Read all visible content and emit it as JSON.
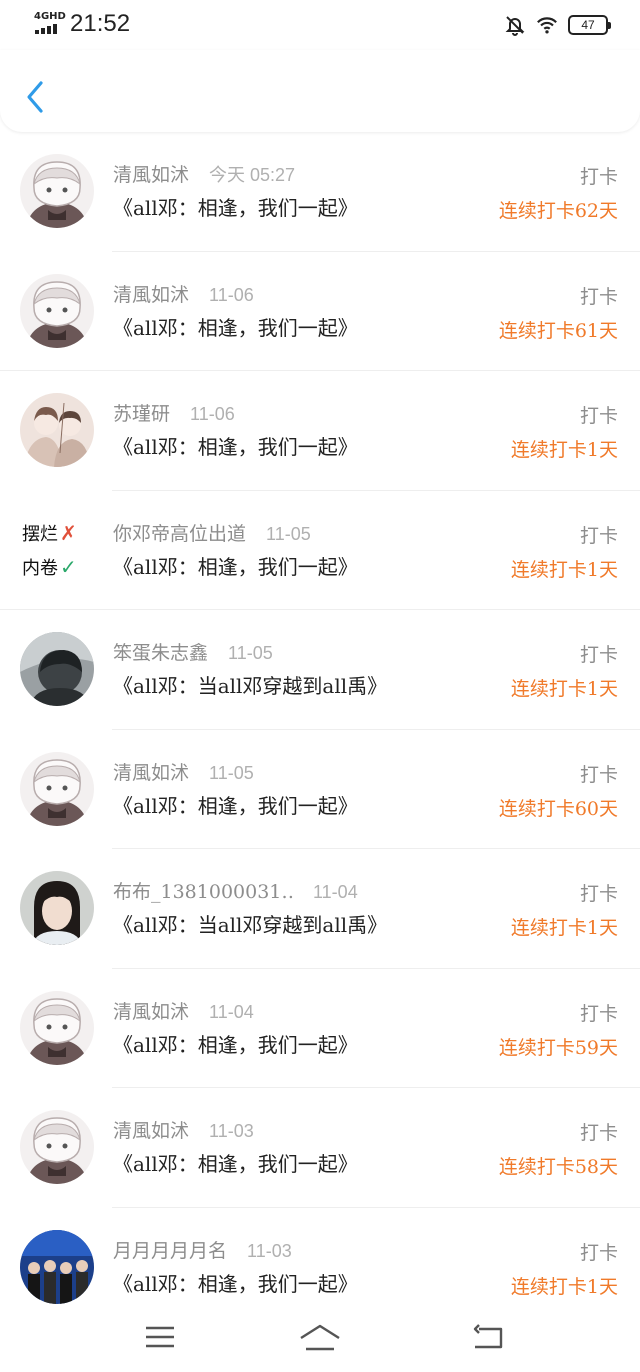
{
  "status_bar": {
    "network": "4GHD",
    "time": "21:52",
    "battery": "47",
    "icons": [
      "signal-icon",
      "mute-bell-icon",
      "wifi-icon",
      "battery-icon"
    ]
  },
  "header": {
    "back_icon": "chevron-left-icon",
    "accent": "#2f9be8"
  },
  "colors": {
    "streak": "#f07a2a",
    "meta": "#8d8d8d",
    "date": "#b0b0b0"
  },
  "entries": [
    {
      "user": "清風如沭",
      "date": "今天 05:27",
      "book": "《all邓：相逢，我们一起》",
      "action": "打卡",
      "streak": "连续打卡62天",
      "avatar": "anime-boy"
    },
    {
      "user": "清風如沭",
      "date": "11-06",
      "book": "《all邓：相逢，我们一起》",
      "action": "打卡",
      "streak": "连续打卡61天",
      "avatar": "anime-boy"
    },
    {
      "user": "苏瑾研",
      "date": "11-06",
      "book": "《all邓：相逢，我们一起》",
      "action": "打卡",
      "streak": "连续打卡1天",
      "avatar": "illustrated-couple"
    },
    {
      "user": "你邓帝高位出道",
      "date": "11-05",
      "book": "《all邓：相逢，我们一起》",
      "action": "打卡",
      "streak": "连续打卡1天",
      "avatar": "text",
      "avatar_text": [
        "摆烂",
        "内卷"
      ],
      "avatar_marks": [
        "✗",
        "✓"
      ]
    },
    {
      "user": "笨蛋朱志鑫",
      "date": "11-05",
      "book": "《all邓：当all邓穿越到all禹》",
      "action": "打卡",
      "streak": "连续打卡1天",
      "avatar": "dark-photo"
    },
    {
      "user": "清風如沭",
      "date": "11-05",
      "book": "《all邓：相逢，我们一起》",
      "action": "打卡",
      "streak": "连续打卡60天",
      "avatar": "anime-boy"
    },
    {
      "user": "布布_1381000031…",
      "date": "11-04",
      "book": "《all邓：当all邓穿越到all禹》",
      "action": "打卡",
      "streak": "连续打卡1天",
      "avatar": "girl-photo"
    },
    {
      "user": "清風如沭",
      "date": "11-04",
      "book": "《all邓：相逢，我们一起》",
      "action": "打卡",
      "streak": "连续打卡59天",
      "avatar": "anime-boy"
    },
    {
      "user": "清風如沭",
      "date": "11-03",
      "book": "《all邓：相逢，我们一起》",
      "action": "打卡",
      "streak": "连续打卡58天",
      "avatar": "anime-boy"
    },
    {
      "user": "月月月月月名",
      "date": "11-03",
      "book": "《all邓：相逢，我们一起》",
      "action": "打卡",
      "streak": "连续打卡1天",
      "avatar": "group-photo"
    }
  ],
  "nav_bar": {
    "icons": [
      "menu-icon",
      "home-icon",
      "back-icon"
    ]
  }
}
